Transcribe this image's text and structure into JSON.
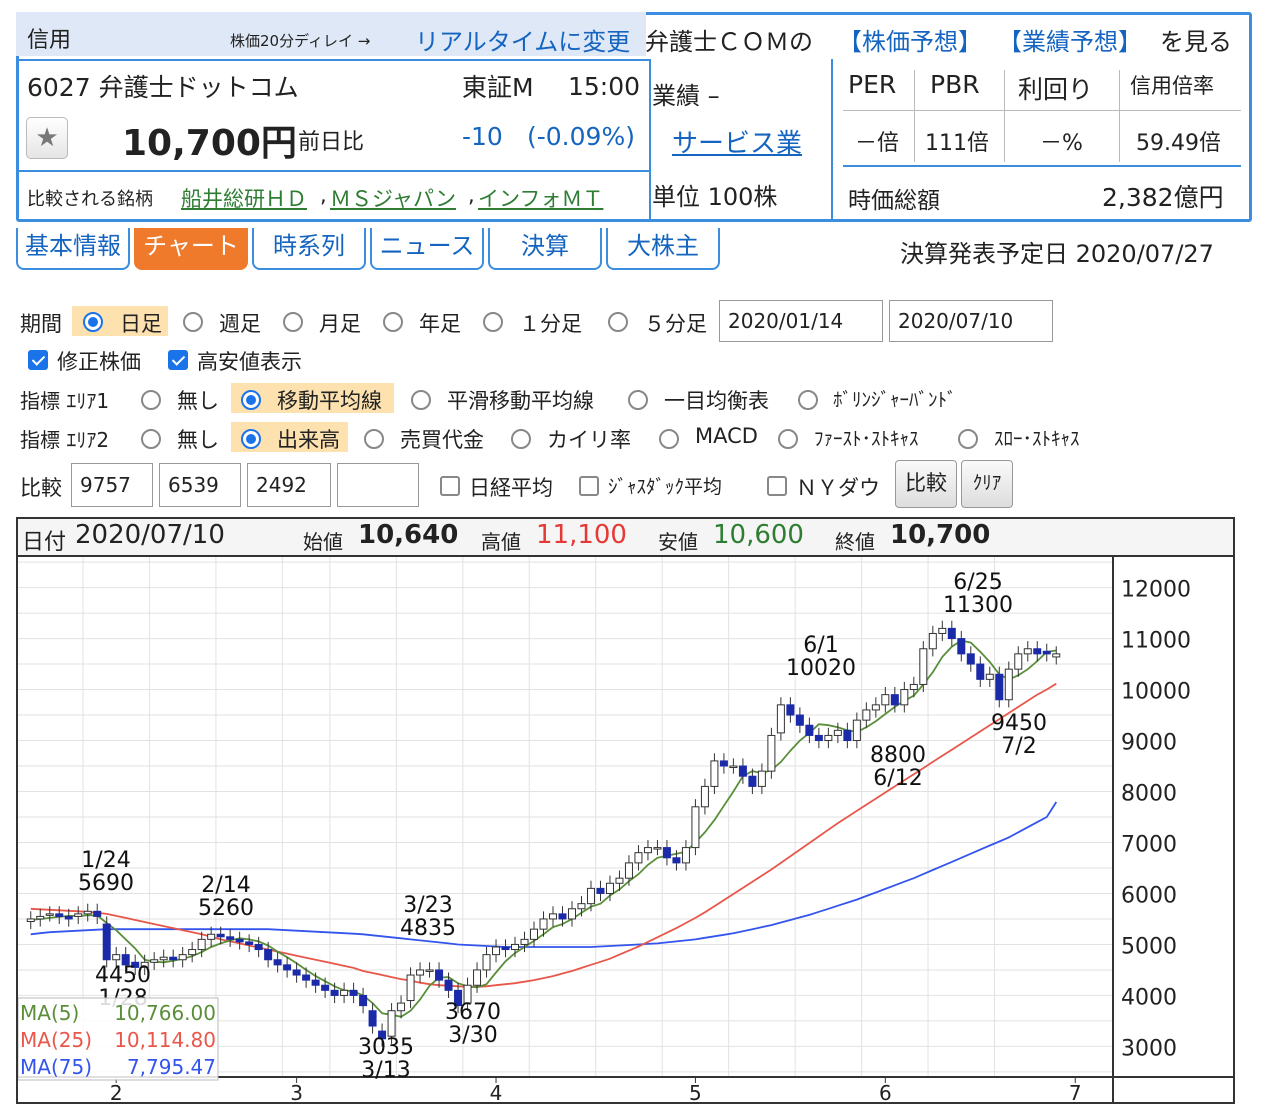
{
  "header": {
    "credit_label": "信用",
    "delay_note": "株価20分ディレイ →",
    "realtime_link": "リアルタイムに変更",
    "forecast_prefix": "弁護士ＣＯＭの",
    "stock_forecast_link": "【株価予想】",
    "earnings_forecast_link": "【業績予想】",
    "forecast_suffix": "を見る",
    "code_name": "6027 弁護士ドットコム",
    "market": "東証M",
    "time": "15:00",
    "price": "10,700円",
    "change_label": "前日比",
    "change": "-10",
    "change_pct": "(-0.09%)",
    "compare_label": "比較される銘柄",
    "compare_links": [
      "船井総研ＨＤ",
      "ＭＳジャパン",
      "インフォＭＴ"
    ],
    "earnings_label": "業績 –",
    "sector_link": "サービス業",
    "unit": "単位 100株",
    "metrics_headers": [
      "PER",
      "PBR",
      "利回り",
      "信用倍率"
    ],
    "metrics_values": [
      "－倍",
      "111倍",
      "－%",
      "59.49倍"
    ],
    "market_cap_label": "時価総額",
    "market_cap": "2,382億円"
  },
  "tabs": [
    "基本情報",
    "チャート",
    "時系列",
    "ニュース",
    "決算",
    "大株主"
  ],
  "announce_date": "決算発表予定日 2020/07/27",
  "form": {
    "period_label": "期間",
    "periods": [
      "日足",
      "週足",
      "月足",
      "年足",
      "１分足",
      "５分足"
    ],
    "date_from": "2020/01/14",
    "date_to": "2020/07/10",
    "adjusted_label": "修正株価",
    "highlow_label": "高安値表示",
    "area1_label": "指標 ｴﾘｱ1",
    "area1_options": [
      "無し",
      "移動平均線",
      "平滑移動平均線",
      "一目均衡表",
      "ﾎﾞﾘﾝｼﾞｬｰﾊﾞﾝﾄﾞ"
    ],
    "area2_label": "指標 ｴﾘｱ2",
    "area2_options": [
      "無し",
      "出来高",
      "売買代金",
      "カイリ率",
      "MACD",
      "ﾌｧｰｽﾄ･ｽﾄｷｬｽ",
      "ｽﾛｰ･ｽﾄｷｬｽ"
    ],
    "compare_label": "比較",
    "compare_codes": [
      "9757",
      "6539",
      "2492",
      ""
    ],
    "nikkei_label": "日経平均",
    "jasdaq_label": "ｼﾞｬｽﾀﾞｯｸ平均",
    "dow_label": "ＮＹダウ",
    "compare_button": "比較",
    "clear_button": "ｸﾘｱ"
  },
  "ohlc_bar": {
    "date_label": "日付",
    "date": "2020/07/10",
    "open_label": "始値",
    "open": "10,640",
    "high_label": "高値",
    "high": "11,100",
    "low_label": "安値",
    "low": "10,600",
    "close_label": "終値",
    "close": "10,700"
  },
  "colors": {
    "accent": "#3b8de0",
    "tab_active": "#f07a2c",
    "candle_up": "#ffffff",
    "candle_down": "#1a2aa8",
    "ma5": "#5a8f3a",
    "ma25": "#e8574a",
    "ma75": "#3355ee",
    "high": "#e53935",
    "low": "#2e7d32"
  },
  "chart_data": {
    "type": "candlestick",
    "ylim": [
      2400,
      12600
    ],
    "y_ticks": [
      "12000",
      "11000",
      "10000",
      "9000",
      "8000",
      "7000",
      "6000",
      "5000",
      "4000",
      "3000"
    ],
    "x_ticks": [
      "2",
      "3",
      "4",
      "5",
      "6",
      "7"
    ],
    "annotations": [
      {
        "date": "1/24",
        "value": "5690"
      },
      {
        "date": "1/28",
        "value": "4450"
      },
      {
        "date": "2/14",
        "value": "5260"
      },
      {
        "date": "3/13",
        "value": "3035"
      },
      {
        "date": "3/23",
        "value": "4835"
      },
      {
        "date": "3/30",
        "value": "3670"
      },
      {
        "date": "6/1",
        "value": "10020"
      },
      {
        "date": "6/12",
        "value": "8800"
      },
      {
        "date": "6/25",
        "value": "11300"
      },
      {
        "date": "7/2",
        "value": "9450"
      }
    ],
    "legend": [
      {
        "name": "MA(5)",
        "value": "10,766.00"
      },
      {
        "name": "MA(25)",
        "value": "10,114.80"
      },
      {
        "name": "MA(75)",
        "value": "7,795.47"
      }
    ],
    "close": [
      5500,
      5550,
      5600,
      5550,
      5500,
      5600,
      5650,
      5550,
      4700,
      4800,
      4600,
      4550,
      4650,
      4700,
      4750,
      4700,
      4800,
      4900,
      5100,
      5200,
      5150,
      5100,
      5050,
      5000,
      4900,
      4700,
      4600,
      4500,
      4400,
      4300,
      4200,
      4100,
      4000,
      4100,
      4000,
      3800,
      3400,
      3150,
      3700,
      3850,
      4400,
      4500,
      4500,
      4300,
      4100,
      3800,
      4200,
      4500,
      4800,
      4950,
      4900,
      5000,
      5100,
      5300,
      5500,
      5600,
      5500,
      5700,
      5800,
      6100,
      6000,
      6200,
      6300,
      6600,
      6800,
      6900,
      6900,
      6700,
      6600,
      6900,
      7700,
      8100,
      8600,
      8500,
      8500,
      8300,
      8100,
      8400,
      9100,
      9700,
      9500,
      9300,
      9100,
      9000,
      9100,
      9200,
      9000,
      9400,
      9600,
      9700,
      9900,
      9700,
      10000,
      10100,
      10800,
      11100,
      11200,
      11000,
      10700,
      10500,
      10200,
      10300,
      9800,
      10400,
      10700,
      10800,
      10700,
      10700,
      10700
    ],
    "open": [
      5450,
      5500,
      5600,
      5600,
      5550,
      5550,
      5600,
      5650,
      5400,
      4700,
      4800,
      4650,
      4550,
      4650,
      4700,
      4750,
      4700,
      4800,
      4900,
      5100,
      5200,
      5150,
      5100,
      5050,
      5000,
      4900,
      4700,
      4600,
      4500,
      4400,
      4300,
      4200,
      4100,
      4000,
      4100,
      4000,
      3700,
      3300,
      3200,
      3700,
      3900,
      4400,
      4500,
      4500,
      4300,
      4100,
      3850,
      4200,
      4500,
      4800,
      4950,
      4900,
      5000,
      5100,
      5300,
      5500,
      5600,
      5500,
      5700,
      5800,
      6100,
      6000,
      6200,
      6300,
      6600,
      6800,
      6900,
      6900,
      6700,
      6600,
      6900,
      7700,
      8100,
      8600,
      8500,
      8500,
      8300,
      8100,
      8400,
      9150,
      9700,
      9500,
      9300,
      9100,
      9000,
      9100,
      9200,
      9000,
      9400,
      9600,
      9700,
      9900,
      9700,
      10000,
      10100,
      10800,
      11100,
      11200,
      11000,
      10700,
      10500,
      10200,
      10300,
      9800,
      10400,
      10700,
      10800,
      10750,
      10640
    ],
    "ma5": [
      5480,
      5500,
      5520,
      5540,
      5560,
      5560,
      5570,
      5570,
      5420,
      5280,
      5100,
      4920,
      4700,
      4660,
      4650,
      4680,
      4720,
      4770,
      4850,
      4950,
      5020,
      5080,
      5120,
      5100,
      5060,
      4980,
      4860,
      4750,
      4630,
      4500,
      4380,
      4280,
      4180,
      4100,
      4080,
      4000,
      3850,
      3650,
      3620,
      3580,
      3700,
      3920,
      4190,
      4350,
      4360,
      4240,
      4180,
      4160,
      4220,
      4450,
      4670,
      4830,
      4950,
      5070,
      5200,
      5340,
      5400,
      5500,
      5620,
      5740,
      5800,
      5960,
      6080,
      6240,
      6380,
      6560,
      6700,
      6740,
      6780,
      6820,
      7000,
      7200,
      7440,
      7720,
      8000,
      8300,
      8400,
      8360,
      8420,
      8580,
      8800,
      9000,
      9150,
      9320,
      9300,
      9260,
      9200,
      9170,
      9260,
      9380,
      9520,
      9660,
      9780,
      9880,
      10100,
      10340,
      10640,
      10840,
      10960,
      10920,
      10740,
      10540,
      10300,
      10200,
      10280,
      10400,
      10560,
      10740,
      10766
    ],
    "ma25": [
      5700,
      5690,
      5680,
      5670,
      5660,
      5650,
      5640,
      5620,
      5600,
      5560,
      5520,
      5480,
      5440,
      5400,
      5360,
      5320,
      5280,
      5240,
      5200,
      5150,
      5100,
      5060,
      5020,
      4980,
      4940,
      4900,
      4860,
      4820,
      4780,
      4740,
      4700,
      4660,
      4620,
      4580,
      4540,
      4480,
      4440,
      4400,
      4360,
      4320,
      4290,
      4250,
      4220,
      4200,
      4190,
      4180,
      4170,
      4170,
      4180,
      4200,
      4220,
      4240,
      4270,
      4300,
      4340,
      4380,
      4430,
      4480,
      4540,
      4600,
      4660,
      4720,
      4800,
      4880,
      4960,
      5050,
      5140,
      5230,
      5320,
      5420,
      5520,
      5630,
      5750,
      5870,
      5990,
      6110,
      6230,
      6350,
      6470,
      6600,
      6730,
      6860,
      6990,
      7120,
      7250,
      7380,
      7500,
      7620,
      7740,
      7860,
      7980,
      8100,
      8220,
      8340,
      8460,
      8580,
      8700,
      8820,
      8940,
      9060,
      9180,
      9300,
      9420,
      9540,
      9660,
      9780,
      9900,
      10000,
      10115
    ],
    "ma75": [
      5200,
      5220,
      5240,
      5250,
      5260,
      5270,
      5280,
      5290,
      5300,
      5300,
      5300,
      5300,
      5300,
      5300,
      5300,
      5300,
      5300,
      5300,
      5300,
      5300,
      5300,
      5300,
      5300,
      5300,
      5300,
      5300,
      5290,
      5280,
      5270,
      5260,
      5250,
      5240,
      5230,
      5220,
      5210,
      5200,
      5180,
      5160,
      5140,
      5120,
      5100,
      5080,
      5060,
      5040,
      5020,
      5000,
      4990,
      4980,
      4970,
      4960,
      4950,
      4950,
      4950,
      4950,
      4950,
      4950,
      4950,
      4950,
      4950,
      4950,
      4960,
      4970,
      4980,
      4990,
      5000,
      5010,
      5020,
      5040,
      5060,
      5080,
      5100,
      5130,
      5160,
      5190,
      5220,
      5260,
      5300,
      5340,
      5380,
      5430,
      5480,
      5530,
      5580,
      5640,
      5700,
      5760,
      5820,
      5880,
      5950,
      6020,
      6090,
      6160,
      6230,
      6300,
      6380,
      6460,
      6540,
      6620,
      6700,
      6780,
      6860,
      6940,
      7020,
      7100,
      7200,
      7300,
      7400,
      7500,
      7795
    ]
  }
}
